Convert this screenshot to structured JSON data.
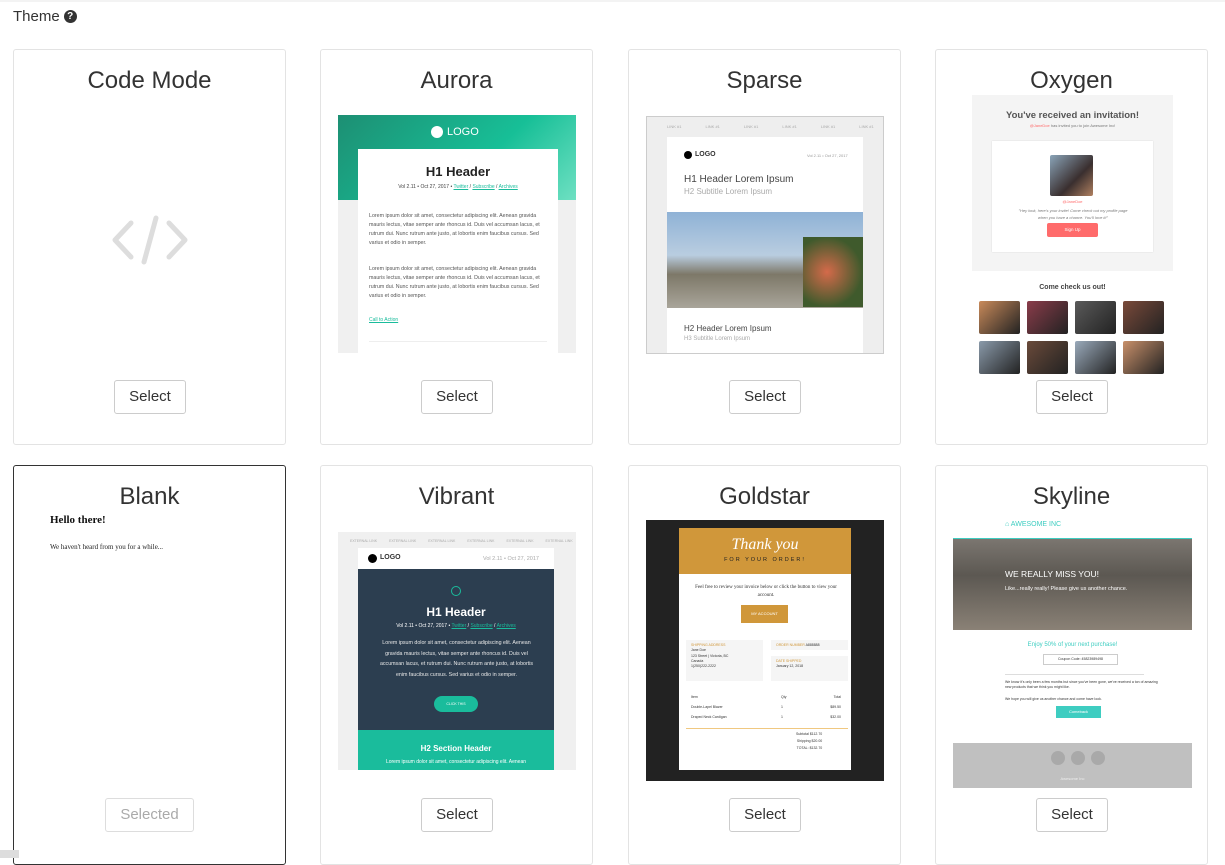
{
  "header": {
    "label": "Theme",
    "help_icon": "question-circle-icon"
  },
  "themes": [
    {
      "name": "Code Mode",
      "button": "Select",
      "icon": "code-icon"
    },
    {
      "name": "Aurora",
      "button": "Select"
    },
    {
      "name": "Sparse",
      "button": "Select"
    },
    {
      "name": "Oxygen",
      "button": "Select"
    },
    {
      "name": "Blank",
      "button": "Selected",
      "selected": true
    },
    {
      "name": "Vibrant",
      "button": "Select"
    },
    {
      "name": "Goldstar",
      "button": "Select"
    },
    {
      "name": "Skyline",
      "button": "Select"
    }
  ],
  "previews": {
    "aurora": {
      "logo": "LOGO",
      "h1": "H1 Header",
      "meta": "Vol 2.11 • Oct 27, 2017 •",
      "links": [
        "Twitter",
        "Subscribe",
        "Archives"
      ],
      "p": "Lorem ipsum dolor sit amet, consectetur adipiscing elit. Aenean gravida mauris lectus, vitae semper ante rhoncus id. Duis vel accumsan lacus, et rutrum dui. Nunc rutrum ante justo, at lobortis enim faucibus cursus. Sed varius et odio in semper.",
      "cta": "Call to Action",
      "accent": "#1abc9c"
    },
    "sparse": {
      "nav": "LINK #1",
      "logo": "LOGO",
      "date": "Vol 2.11 • Oct 27, 2017",
      "h1": "H1 Header Lorem Ipsum",
      "h2": "H2 Subtitle Lorem Ipsum",
      "h2b": "H2 Header Lorem Ipsum",
      "h3": "H3 Subtitle Lorem Ipsum"
    },
    "oxygen": {
      "title": "You've received an invitation!",
      "sub_user": "@JaneDoe",
      "sub": "has invited you to join Awesome Inc!",
      "user": "@JaneDoe",
      "quote": "\"Hey look, here's your invite! Come check out my profile page when you have a chance. You'll love it!\"",
      "signup": "Sign Up",
      "come": "Come check us out!",
      "accent": "#ff6b6b"
    },
    "blank": {
      "h": "Hello there!",
      "p": "We haven't heard from you for a while..."
    },
    "vibrant": {
      "nav": "EXTERNAL LINK",
      "logo": "LOGO",
      "date": "Vol 2.11 • Oct 27, 2017",
      "h1": "H1 Header",
      "meta": "Vol 2.11 • Oct 27, 2017 •",
      "links": [
        "Twitter",
        "Subscribe",
        "Archives"
      ],
      "p": "Lorem ipsum dolor sit amet, consectetur adipiscing elit. Aenean gravida mauris lectus, vitae semper ante rhoncus id. Duis vel accumsan lacus, et rutrum dui. Nunc rutrum ante justo, at lobortis enim faucibus cursus. Sed varius et odio in semper.",
      "cta": "CLICK THIS",
      "h2": "H2 Section Header",
      "p2": "Lorem ipsum dolor sit amet, consectetur adipiscing elit. Aenean",
      "dark": "#2c3e50",
      "accent": "#1abc9c"
    },
    "goldstar": {
      "h1": "Thank you",
      "h2": "FOR YOUR ORDER!",
      "p": "Feel free to review your invoice below or click the button to view your account.",
      "btn": "MY ACCOUNT",
      "ship": "SHIPPING ADDRESS",
      "addr": "Jane Doe\n123 Street | Victoria, BC\nCanada\n1(250)222-2222",
      "order": "ORDER NUMBER",
      "order_no": "A888888",
      "shipped": "DATE SHIPPED",
      "date": "January 12, 2018",
      "cols": [
        "Item",
        "Qty",
        "Total"
      ],
      "rows": [
        [
          "Double-Lapel Blazer",
          "1",
          "$89.50"
        ],
        [
          "Draped Neck Cardigan",
          "1",
          "$32.00"
        ]
      ],
      "subtotal": "$112.70",
      "shipping": "$20.00",
      "total": "$132.70",
      "accent": "#d0973a"
    },
    "skyline": {
      "brand": "AWESOME INC",
      "hero": "WE REALLY MISS YOU!",
      "hero_sub": "Like...really really! Please give us another chance.",
      "offer": "Enjoy 50% of your next purchase!",
      "coupon": "Coupon Code: 45823989498",
      "p1": "We know it's only been a few months but since you've been gone, we've received a ton of amazing new products that we think you might like.",
      "p2": "We hope you will give us another chance and come have look.",
      "btn": "Comeback",
      "footer": "Awesome Inc",
      "accent": "#3ecdc1"
    }
  }
}
